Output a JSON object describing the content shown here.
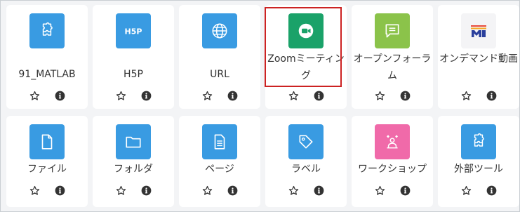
{
  "colors": {
    "blue_tile": "#399be2",
    "green_zoom": "#1aa269",
    "lime_forum": "#8bc34a",
    "pink_workshop": "#f06aa9",
    "light_tile": "#f4f4f6",
    "highlight_border": "#cc2222",
    "action_icon": "#333333"
  },
  "row1": [
    {
      "label": "91_MATLAB",
      "icon": "puzzle-icon"
    },
    {
      "label": "H5P",
      "icon": "h5p-icon"
    },
    {
      "label": "URL",
      "icon": "globe-icon"
    },
    {
      "label": "Zoomミーティング",
      "icon": "video-camera-icon",
      "highlighted": true
    },
    {
      "label": "オープンフォーラム",
      "icon": "chat-bubble-icon"
    },
    {
      "label": "オンデマンド動画",
      "icon": "m-logo-icon"
    }
  ],
  "row2": [
    {
      "label": "ファイル",
      "icon": "file-icon"
    },
    {
      "label": "フォルダ",
      "icon": "folder-icon"
    },
    {
      "label": "ページ",
      "icon": "page-icon"
    },
    {
      "label": "ラベル",
      "icon": "tag-icon"
    },
    {
      "label": "ワークショップ",
      "icon": "workshop-icon"
    },
    {
      "label": "外部ツール",
      "icon": "puzzle-icon"
    }
  ],
  "action_icons": [
    "star-outline-icon",
    "info-icon"
  ]
}
